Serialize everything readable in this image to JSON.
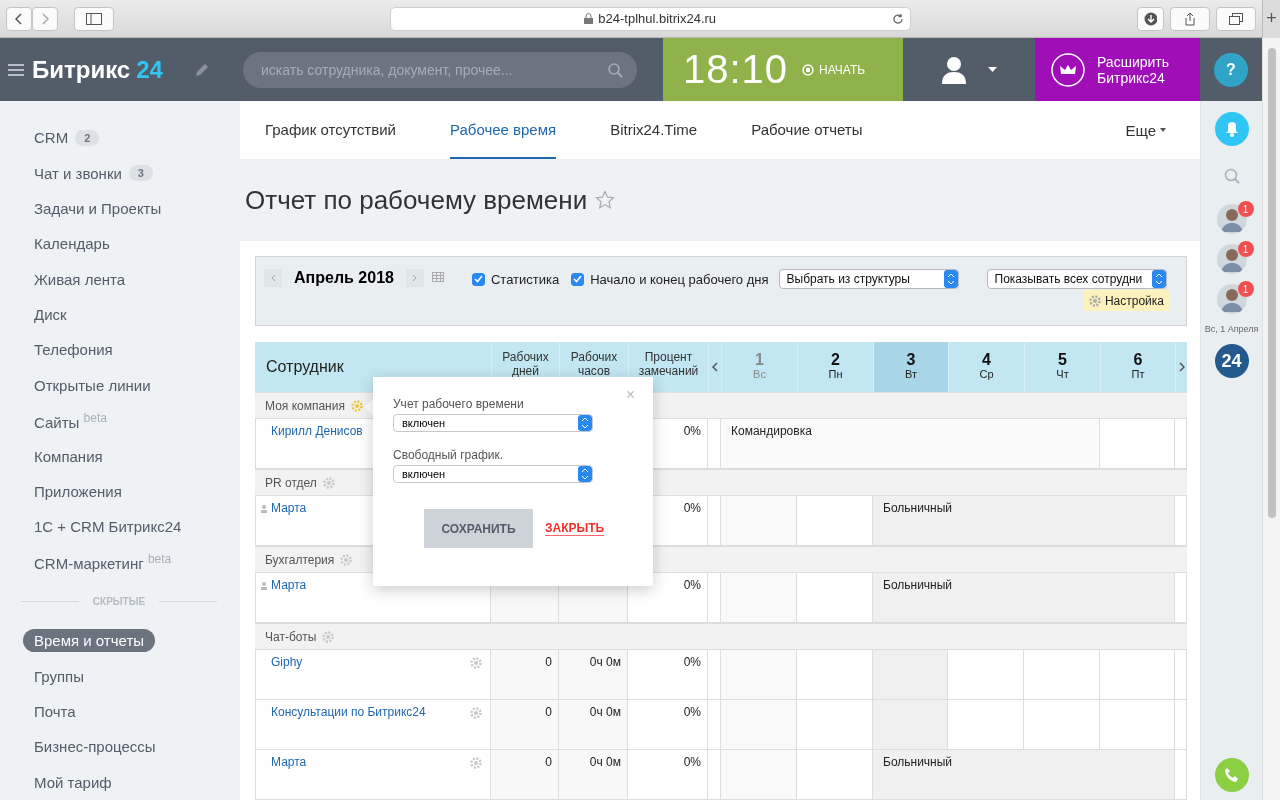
{
  "browser": {
    "url": "b24-tplhul.bitrix24.ru",
    "new_tab": "+"
  },
  "header": {
    "logo": "Битрикс",
    "logo_suffix": "24",
    "search": {
      "placeholder": "искать сотрудника, документ, прочее..."
    },
    "clock": {
      "time": "18:10",
      "action": "НАЧАТЬ"
    },
    "upgrade": "Расширить Битрикс24",
    "help": "?"
  },
  "sidebar": {
    "items": [
      {
        "label": "CRM",
        "counter": "2",
        "selected": false
      },
      {
        "label": "Чат и звонки",
        "counter": "3",
        "selected": false
      },
      {
        "label": "Задачи и Проекты",
        "selected": false
      },
      {
        "label": "Календарь",
        "selected": false
      },
      {
        "label": "Живая лента",
        "selected": false
      },
      {
        "label": "Диск",
        "selected": false
      },
      {
        "label": "Телефония",
        "selected": false
      },
      {
        "label": "Открытые линии",
        "selected": false
      },
      {
        "label": "Сайты $^{beta}$",
        "selected": false
      },
      {
        "label": "Компания",
        "selected": false
      },
      {
        "label": "Приложения",
        "selected": false
      },
      {
        "label": "1С + CRM Битрикс24",
        "selected": false
      },
      {
        "label": "CRM-маркетинг $^{beta}$",
        "selected": false
      }
    ],
    "hidden_title": "СКРЫТЫЕ",
    "hidden_items": [
      {
        "label": "Время и отчеты",
        "selected": true
      },
      {
        "label": "Группы",
        "selected": false
      },
      {
        "label": "Почта",
        "selected": false
      },
      {
        "label": "Бизнес-процессы",
        "selected": false
      },
      {
        "label": "Мой тариф",
        "selected": false
      }
    ]
  },
  "tabs": [
    {
      "label": "График отсутствий",
      "selected": false
    },
    {
      "label": "Рабочее время",
      "selected": true
    },
    {
      "label": "Bitrix24.Time",
      "selected": false
    },
    {
      "label": "Рабочие отчеты",
      "selected": false
    }
  ],
  "tabs_more": "Еще",
  "title": "Отчет по рабочему времени",
  "filter": {
    "month": "Апрель 2018",
    "checkboxes": [
      {
        "label": "Статистика",
        "checked": true
      },
      {
        "label": "Начало и конец рабочего дня",
        "checked": true
      }
    ],
    "department_select": "Выбрать из структуры",
    "employees_select": "Показывать всех сотрудни",
    "settings": "Настройка"
  },
  "table": {
    "columns": [
      "Сотрудник",
      "Рабочих дней",
      "Рабочих часов",
      "Процент замечаний"
    ],
    "days": [
      {
        "number": "1",
        "weekday": "Вс",
        "weekend": true,
        "selected": false
      },
      {
        "number": "2",
        "weekday": "Пн",
        "weekend": false,
        "selected": false
      },
      {
        "number": "3",
        "weekday": "Вт",
        "weekend": false,
        "selected": true
      },
      {
        "number": "4",
        "weekday": "Ср",
        "weekend": false,
        "selected": false
      },
      {
        "number": "5",
        "weekday": "Чт",
        "weekend": false,
        "selected": false
      },
      {
        "number": "6",
        "weekday": "Пт",
        "weekend": false,
        "selected": false
      }
    ],
    "rows": [
      {
        "kind": "group",
        "name": "Моя компания",
        "highlighted": true
      },
      {
        "kind": "person",
        "name": "Кирилл Денисов",
        "percent": "0%",
        "cells": [
          {
            "kind": "trip",
            "text": "Командировка"
          },
          {
            "kind": "continued"
          },
          {
            "kind": "continued"
          },
          {
            "kind": "continued"
          },
          {
            "kind": "continued"
          },
          {
            "kind": "workday"
          }
        ]
      },
      {
        "kind": "group",
        "name": "PR отдел",
        "highlighted": false
      },
      {
        "kind": "member",
        "name": "Марта",
        "percent": "0%",
        "cells": [
          {
            "kind": "weekend"
          },
          {
            "kind": "workday"
          },
          {
            "kind": "sick",
            "text": "Больничный"
          },
          {
            "kind": "continued"
          },
          {
            "kind": "continued"
          },
          {
            "kind": "continued"
          }
        ]
      },
      {
        "kind": "group",
        "name": "Бухгалтерия",
        "highlighted": false
      },
      {
        "kind": "member",
        "name": "Марта",
        "percent": "0%",
        "cells": [
          {
            "kind": "weekend"
          },
          {
            "kind": "workday"
          },
          {
            "kind": "sick",
            "text": "Больничный"
          },
          {
            "kind": "continued"
          },
          {
            "kind": "continued"
          },
          {
            "kind": "continued"
          }
        ]
      },
      {
        "kind": "group",
        "name": "Чат-боты",
        "highlighted": false
      },
      {
        "kind": "bot",
        "name": "Giphy",
        "work_days": "0",
        "work_hours": "0ч 0м",
        "percent": "0%",
        "cells": [
          {
            "kind": "weekend"
          },
          {
            "kind": "workday"
          },
          {
            "kind": "today"
          },
          {
            "kind": "workday"
          },
          {
            "kind": "workday"
          },
          {
            "kind": "workday"
          }
        ]
      },
      {
        "kind": "bot",
        "name": "Консультации по Битрикс24",
        "work_days": "0",
        "work_hours": "0ч 0м",
        "percent": "0%",
        "cells": [
          {
            "kind": "weekend"
          },
          {
            "kind": "workday"
          },
          {
            "kind": "today"
          },
          {
            "kind": "workday"
          },
          {
            "kind": "workday"
          },
          {
            "kind": "workday"
          }
        ]
      },
      {
        "kind": "bot",
        "name": "Марта",
        "work_days": "0",
        "work_hours": "0ч 0м",
        "percent": "0%",
        "cells": [
          {
            "kind": "weekend"
          },
          {
            "kind": "workday"
          },
          {
            "kind": "sick",
            "text": "Больничный"
          },
          {
            "kind": "continued"
          },
          {
            "kind": "continued"
          },
          {
            "kind": "continued"
          }
        ]
      }
    ]
  },
  "popup": {
    "close_icon": "×",
    "fields": [
      {
        "label": "Учет рабочего времени",
        "value": "включен"
      },
      {
        "label": "Свободный график.",
        "value": "включен"
      }
    ],
    "save": "СОХРАНИТЬ",
    "close": "ЗАКРЫТЬ"
  },
  "rail": {
    "avatars": [
      {
        "badge": "1"
      },
      {
        "badge": "1"
      },
      {
        "badge": "1"
      }
    ],
    "date": "Вс, 1 Апреля",
    "logo": "24"
  }
}
